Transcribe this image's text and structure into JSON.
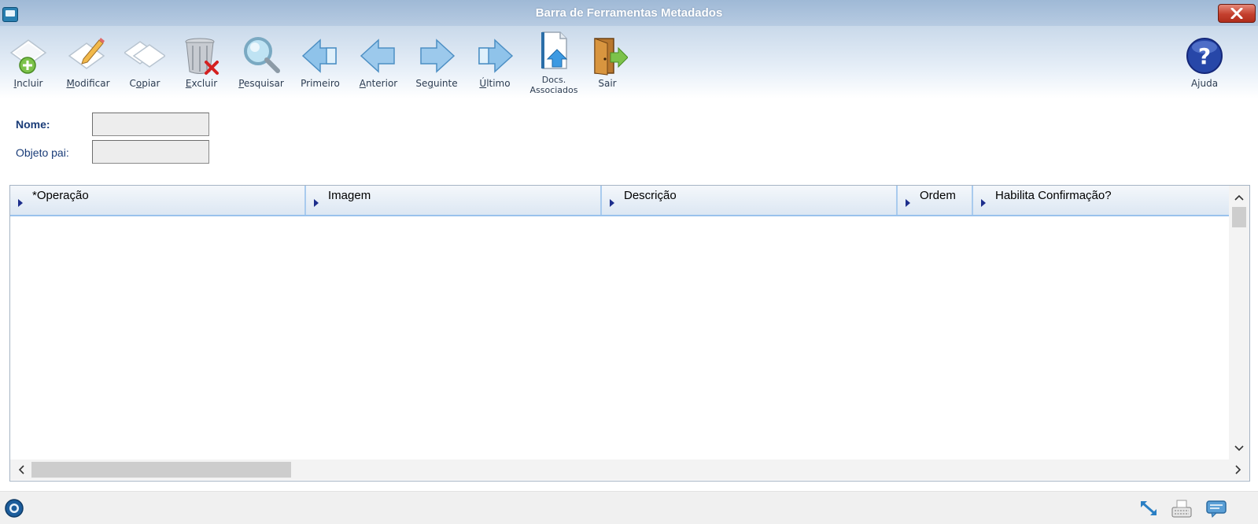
{
  "window": {
    "title": "Barra de Ferramentas Metadados",
    "icons": {
      "app": "app-window-icon",
      "close": "close-icon"
    }
  },
  "toolbar": {
    "buttons": [
      {
        "id": "incluir",
        "label": "Incluir",
        "accel": "I",
        "icon": "add-document-icon"
      },
      {
        "id": "modificar",
        "label": "Modificar",
        "accel": "M",
        "icon": "edit-document-icon"
      },
      {
        "id": "copiar",
        "label": "Copiar",
        "accel": "o",
        "icon": "copy-documents-icon"
      },
      {
        "id": "excluir",
        "label": "Excluir",
        "accel": "E",
        "icon": "trash-delete-icon"
      },
      {
        "id": "pesquisar",
        "label": "Pesquisar",
        "accel": "P",
        "icon": "magnifier-icon"
      },
      {
        "id": "primeiro",
        "label": "Primeiro",
        "accel": "",
        "icon": "first-record-icon"
      },
      {
        "id": "anterior",
        "label": "Anterior",
        "accel": "A",
        "icon": "previous-record-icon"
      },
      {
        "id": "seguinte",
        "label": "Seguinte",
        "accel": "g",
        "icon": "next-record-icon"
      },
      {
        "id": "ultimo",
        "label": "Último",
        "accel": "Ú",
        "icon": "last-record-icon"
      },
      {
        "id": "docs",
        "label_line1": "Docs.",
        "label_line2": "Associados",
        "icon": "associated-docs-icon"
      },
      {
        "id": "sair",
        "label": "Sair",
        "accel": "",
        "icon": "exit-door-icon"
      }
    ],
    "help": {
      "label": "Ajuda",
      "icon": "help-icon"
    }
  },
  "form": {
    "nome_label": "Nome:",
    "nome_value": "",
    "objeto_pai_label": "Objeto pai:",
    "objeto_pai_value": ""
  },
  "grid": {
    "columns": [
      {
        "label": "*Operação"
      },
      {
        "label": "Imagem"
      },
      {
        "label": "Descrição"
      },
      {
        "label": "Ordem"
      },
      {
        "label": "Habilita Confirmação?"
      }
    ],
    "rows": []
  },
  "statusbar": {
    "icons": [
      "status-globe-icon",
      "resize-icon",
      "keyboard-icon",
      "chat-icon"
    ]
  },
  "colors": {
    "title_gradient_top": "#9fb9d6",
    "label_blue": "#1a3c78",
    "close_red": "#c4402e",
    "header_border": "#99c2ec"
  }
}
